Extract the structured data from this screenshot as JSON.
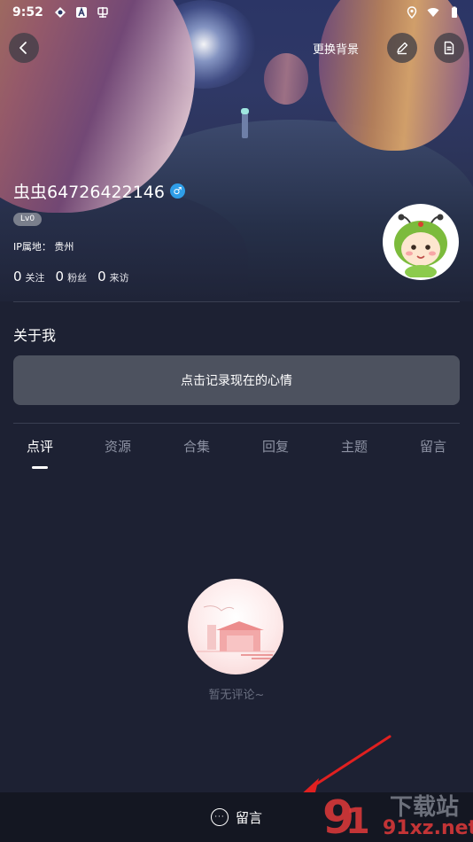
{
  "status_bar": {
    "time": "9:52",
    "left_icons": [
      "app-icon",
      "a-icon",
      "chongchong-icon"
    ],
    "right_icons": [
      "location-icon",
      "wifi-icon",
      "battery-icon"
    ]
  },
  "header": {
    "back_icon": "chevron-left-icon",
    "change_bg_label": "更换背景",
    "edit_icon": "pencil-icon",
    "doc_icon": "document-icon"
  },
  "profile": {
    "username": "虫虫64726422146",
    "gender_icon": "♂",
    "level": "Lv0",
    "ip_label": "IP属地：",
    "ip_value": "贵州",
    "stats": [
      {
        "value": "0",
        "label": "关注"
      },
      {
        "value": "0",
        "label": "粉丝"
      },
      {
        "value": "0",
        "label": "来访"
      }
    ],
    "avatar_icon": "avatar-character"
  },
  "about": {
    "title": "关于我",
    "mood_button": "点击记录现在的心情"
  },
  "tabs": [
    {
      "label": "点评",
      "active": true
    },
    {
      "label": "资源",
      "active": false
    },
    {
      "label": "合集",
      "active": false
    },
    {
      "label": "回复",
      "active": false
    },
    {
      "label": "主题",
      "active": false
    },
    {
      "label": "留言",
      "active": false
    }
  ],
  "empty_state": {
    "text": "暂无评论~"
  },
  "bottom_bar": {
    "icon": "comment-icon",
    "label": "留言"
  },
  "watermark": {
    "text": "91xz.net",
    "brand": "下载站"
  },
  "colors": {
    "background": "#1d2133",
    "bottom_bar": "#141722",
    "mood_button": "#4d525f",
    "gender_badge": "#2f9ee8",
    "tab_inactive": "#8d92a3",
    "arrow": "#e02020"
  }
}
